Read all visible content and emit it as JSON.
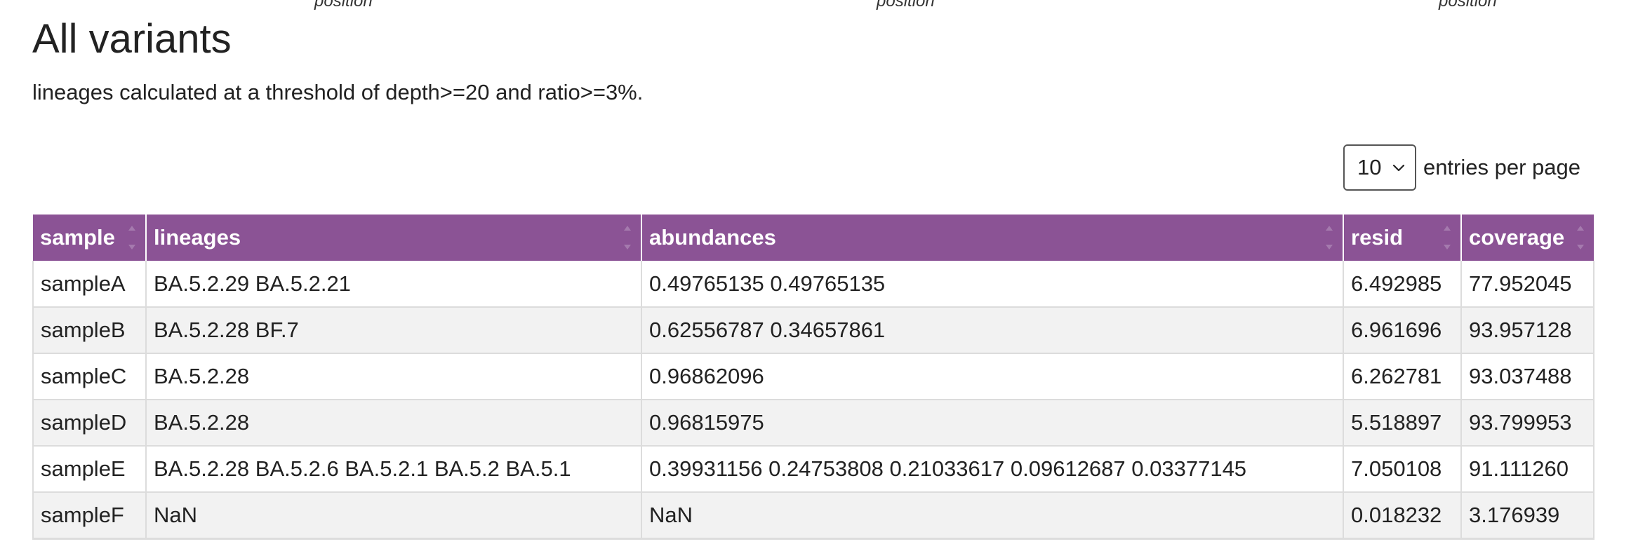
{
  "previous_section": {
    "column_labels": [
      "position",
      "position",
      "position"
    ]
  },
  "title": "All variants",
  "subtitle": "lineages calculated at a threshold of depth>=20 and ratio>=3%.",
  "pagination": {
    "page_size": "10",
    "entries_label": "entries per page"
  },
  "table": {
    "headers": [
      "sample",
      "lineages",
      "abundances",
      "resid",
      "coverage"
    ],
    "rows": [
      [
        "sampleA",
        "BA.5.2.29 BA.5.2.21",
        "0.49765135 0.49765135",
        "6.492985",
        "77.952045"
      ],
      [
        "sampleB",
        "BA.5.2.28 BF.7",
        "0.62556787 0.34657861",
        "6.961696",
        "93.957128"
      ],
      [
        "sampleC",
        "BA.5.2.28",
        "0.96862096",
        "6.262781",
        "93.037488"
      ],
      [
        "sampleD",
        "BA.5.2.28",
        "0.96815975",
        "5.518897",
        "93.799953"
      ],
      [
        "sampleE",
        "BA.5.2.28 BA.5.2.6 BA.5.2.1 BA.5.2 BA.5.1",
        "0.39931156 0.24753808 0.21033617 0.09612687 0.03377145",
        "7.050108",
        "91.111260"
      ],
      [
        "sampleF",
        "NaN",
        "NaN",
        "0.018232",
        "3.176939"
      ]
    ]
  },
  "colors": {
    "header_bg": "#8b5395",
    "header_text": "#ffffff",
    "row_alt_bg": "#f2f2f2"
  },
  "icons": {
    "sort": "sort-arrows-icon",
    "select": "chevron-down-icon"
  }
}
